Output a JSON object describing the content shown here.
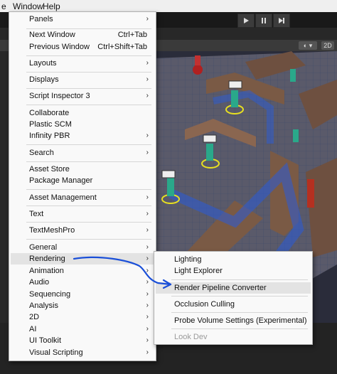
{
  "menubar": {
    "item1": "e",
    "window": "Window",
    "help": "Help"
  },
  "toolbar": {
    "play_icon": "play-icon",
    "pause_icon": "pause-icon",
    "step_icon": "step-icon"
  },
  "scene_toolbar": {
    "mode_2d": "2D"
  },
  "window_menu": {
    "items": [
      {
        "label": "Panels",
        "submenu": true
      },
      {
        "label": "Next Window",
        "shortcut": "Ctrl+Tab"
      },
      {
        "label": "Previous Window",
        "shortcut": "Ctrl+Shift+Tab"
      },
      {
        "label": "Layouts",
        "submenu": true
      },
      {
        "label": "Displays",
        "submenu": true
      },
      {
        "label": "Script Inspector 3",
        "submenu": true
      },
      {
        "label": "Collaborate"
      },
      {
        "label": "Plastic SCM"
      },
      {
        "label": "Infinity PBR",
        "submenu": true
      },
      {
        "label": "Search",
        "submenu": true
      },
      {
        "label": "Asset Store"
      },
      {
        "label": "Package Manager"
      },
      {
        "label": "Asset Management",
        "submenu": true
      },
      {
        "label": "Text",
        "submenu": true
      },
      {
        "label": "TextMeshPro",
        "submenu": true
      },
      {
        "label": "General",
        "submenu": true
      },
      {
        "label": "Rendering",
        "submenu": true,
        "highlighted": true
      },
      {
        "label": "Animation",
        "submenu": true
      },
      {
        "label": "Audio",
        "submenu": true
      },
      {
        "label": "Sequencing",
        "submenu": true
      },
      {
        "label": "Analysis",
        "submenu": true
      },
      {
        "label": "2D",
        "submenu": true
      },
      {
        "label": "AI",
        "submenu": true
      },
      {
        "label": "UI Toolkit",
        "submenu": true
      },
      {
        "label": "Visual Scripting",
        "submenu": true
      }
    ]
  },
  "rendering_submenu": {
    "items": [
      {
        "label": "Lighting"
      },
      {
        "label": "Light Explorer"
      },
      {
        "label": "Render Pipeline Converter",
        "highlighted": true
      },
      {
        "label": "Occlusion Culling"
      },
      {
        "label": "Probe Volume Settings (Experimental)"
      },
      {
        "label": "Look Dev",
        "disabled": true
      }
    ]
  },
  "colors": {
    "annotation_arrow": "#1a4fd8",
    "menu_bg": "#f9f9f9",
    "highlight": "#e3e3e3"
  }
}
